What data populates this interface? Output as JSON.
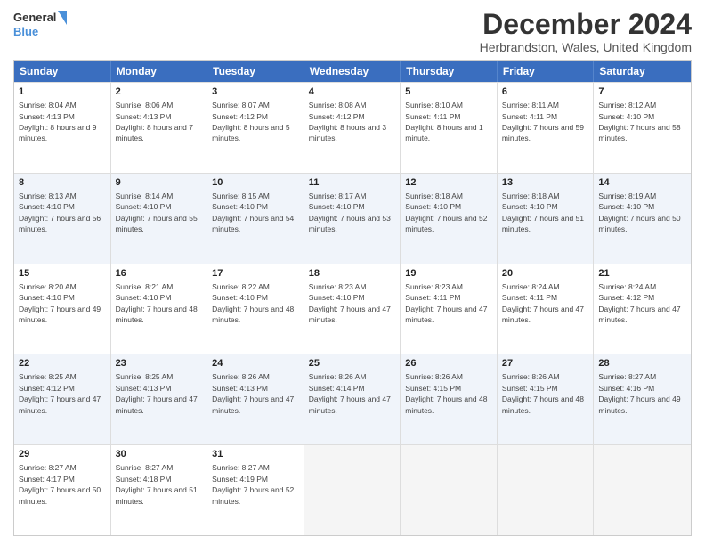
{
  "header": {
    "logo_line1": "General",
    "logo_line2": "Blue",
    "month_title": "December 2024",
    "location": "Herbrandston, Wales, United Kingdom"
  },
  "calendar": {
    "days_of_week": [
      "Sunday",
      "Monday",
      "Tuesday",
      "Wednesday",
      "Thursday",
      "Friday",
      "Saturday"
    ],
    "rows": [
      [
        {
          "day": "1",
          "sunrise": "Sunrise: 8:04 AM",
          "sunset": "Sunset: 4:13 PM",
          "daylight": "Daylight: 8 hours and 9 minutes."
        },
        {
          "day": "2",
          "sunrise": "Sunrise: 8:06 AM",
          "sunset": "Sunset: 4:13 PM",
          "daylight": "Daylight: 8 hours and 7 minutes."
        },
        {
          "day": "3",
          "sunrise": "Sunrise: 8:07 AM",
          "sunset": "Sunset: 4:12 PM",
          "daylight": "Daylight: 8 hours and 5 minutes."
        },
        {
          "day": "4",
          "sunrise": "Sunrise: 8:08 AM",
          "sunset": "Sunset: 4:12 PM",
          "daylight": "Daylight: 8 hours and 3 minutes."
        },
        {
          "day": "5",
          "sunrise": "Sunrise: 8:10 AM",
          "sunset": "Sunset: 4:11 PM",
          "daylight": "Daylight: 8 hours and 1 minute."
        },
        {
          "day": "6",
          "sunrise": "Sunrise: 8:11 AM",
          "sunset": "Sunset: 4:11 PM",
          "daylight": "Daylight: 7 hours and 59 minutes."
        },
        {
          "day": "7",
          "sunrise": "Sunrise: 8:12 AM",
          "sunset": "Sunset: 4:10 PM",
          "daylight": "Daylight: 7 hours and 58 minutes."
        }
      ],
      [
        {
          "day": "8",
          "sunrise": "Sunrise: 8:13 AM",
          "sunset": "Sunset: 4:10 PM",
          "daylight": "Daylight: 7 hours and 56 minutes."
        },
        {
          "day": "9",
          "sunrise": "Sunrise: 8:14 AM",
          "sunset": "Sunset: 4:10 PM",
          "daylight": "Daylight: 7 hours and 55 minutes."
        },
        {
          "day": "10",
          "sunrise": "Sunrise: 8:15 AM",
          "sunset": "Sunset: 4:10 PM",
          "daylight": "Daylight: 7 hours and 54 minutes."
        },
        {
          "day": "11",
          "sunrise": "Sunrise: 8:17 AM",
          "sunset": "Sunset: 4:10 PM",
          "daylight": "Daylight: 7 hours and 53 minutes."
        },
        {
          "day": "12",
          "sunrise": "Sunrise: 8:18 AM",
          "sunset": "Sunset: 4:10 PM",
          "daylight": "Daylight: 7 hours and 52 minutes."
        },
        {
          "day": "13",
          "sunrise": "Sunrise: 8:18 AM",
          "sunset": "Sunset: 4:10 PM",
          "daylight": "Daylight: 7 hours and 51 minutes."
        },
        {
          "day": "14",
          "sunrise": "Sunrise: 8:19 AM",
          "sunset": "Sunset: 4:10 PM",
          "daylight": "Daylight: 7 hours and 50 minutes."
        }
      ],
      [
        {
          "day": "15",
          "sunrise": "Sunrise: 8:20 AM",
          "sunset": "Sunset: 4:10 PM",
          "daylight": "Daylight: 7 hours and 49 minutes."
        },
        {
          "day": "16",
          "sunrise": "Sunrise: 8:21 AM",
          "sunset": "Sunset: 4:10 PM",
          "daylight": "Daylight: 7 hours and 48 minutes."
        },
        {
          "day": "17",
          "sunrise": "Sunrise: 8:22 AM",
          "sunset": "Sunset: 4:10 PM",
          "daylight": "Daylight: 7 hours and 48 minutes."
        },
        {
          "day": "18",
          "sunrise": "Sunrise: 8:23 AM",
          "sunset": "Sunset: 4:10 PM",
          "daylight": "Daylight: 7 hours and 47 minutes."
        },
        {
          "day": "19",
          "sunrise": "Sunrise: 8:23 AM",
          "sunset": "Sunset: 4:11 PM",
          "daylight": "Daylight: 7 hours and 47 minutes."
        },
        {
          "day": "20",
          "sunrise": "Sunrise: 8:24 AM",
          "sunset": "Sunset: 4:11 PM",
          "daylight": "Daylight: 7 hours and 47 minutes."
        },
        {
          "day": "21",
          "sunrise": "Sunrise: 8:24 AM",
          "sunset": "Sunset: 4:12 PM",
          "daylight": "Daylight: 7 hours and 47 minutes."
        }
      ],
      [
        {
          "day": "22",
          "sunrise": "Sunrise: 8:25 AM",
          "sunset": "Sunset: 4:12 PM",
          "daylight": "Daylight: 7 hours and 47 minutes."
        },
        {
          "day": "23",
          "sunrise": "Sunrise: 8:25 AM",
          "sunset": "Sunset: 4:13 PM",
          "daylight": "Daylight: 7 hours and 47 minutes."
        },
        {
          "day": "24",
          "sunrise": "Sunrise: 8:26 AM",
          "sunset": "Sunset: 4:13 PM",
          "daylight": "Daylight: 7 hours and 47 minutes."
        },
        {
          "day": "25",
          "sunrise": "Sunrise: 8:26 AM",
          "sunset": "Sunset: 4:14 PM",
          "daylight": "Daylight: 7 hours and 47 minutes."
        },
        {
          "day": "26",
          "sunrise": "Sunrise: 8:26 AM",
          "sunset": "Sunset: 4:15 PM",
          "daylight": "Daylight: 7 hours and 48 minutes."
        },
        {
          "day": "27",
          "sunrise": "Sunrise: 8:26 AM",
          "sunset": "Sunset: 4:15 PM",
          "daylight": "Daylight: 7 hours and 48 minutes."
        },
        {
          "day": "28",
          "sunrise": "Sunrise: 8:27 AM",
          "sunset": "Sunset: 4:16 PM",
          "daylight": "Daylight: 7 hours and 49 minutes."
        }
      ],
      [
        {
          "day": "29",
          "sunrise": "Sunrise: 8:27 AM",
          "sunset": "Sunset: 4:17 PM",
          "daylight": "Daylight: 7 hours and 50 minutes."
        },
        {
          "day": "30",
          "sunrise": "Sunrise: 8:27 AM",
          "sunset": "Sunset: 4:18 PM",
          "daylight": "Daylight: 7 hours and 51 minutes."
        },
        {
          "day": "31",
          "sunrise": "Sunrise: 8:27 AM",
          "sunset": "Sunset: 4:19 PM",
          "daylight": "Daylight: 7 hours and 52 minutes."
        },
        {
          "day": "",
          "sunrise": "",
          "sunset": "",
          "daylight": ""
        },
        {
          "day": "",
          "sunrise": "",
          "sunset": "",
          "daylight": ""
        },
        {
          "day": "",
          "sunrise": "",
          "sunset": "",
          "daylight": ""
        },
        {
          "day": "",
          "sunrise": "",
          "sunset": "",
          "daylight": ""
        }
      ]
    ]
  }
}
